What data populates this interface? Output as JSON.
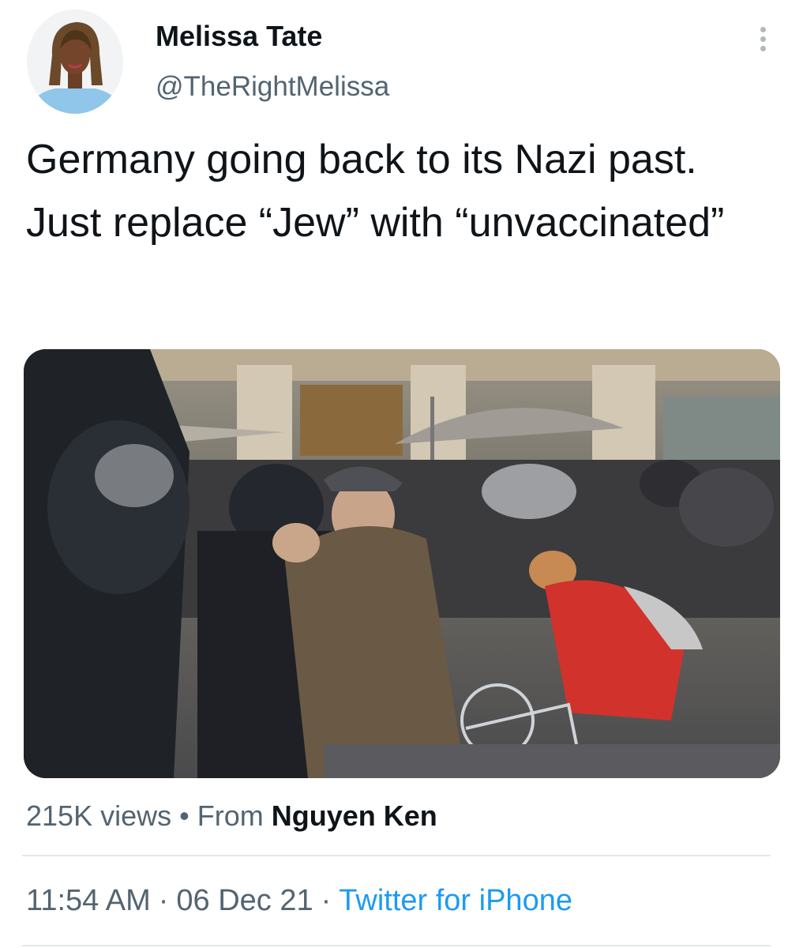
{
  "author": {
    "display_name": "Melissa Tate",
    "handle": "@TheRightMelissa",
    "avatar_icon": "profile-photo"
  },
  "menu_icon": "more-vertical-icon",
  "tweet": {
    "text": "Germany going back to its Nazi past. Just replace “Jew” with “unvaccinated”"
  },
  "media": {
    "type": "video",
    "views": "215K views",
    "separator": "•",
    "from_label": "From",
    "source": "Nguyen Ken"
  },
  "meta": {
    "time": "11:54 AM",
    "date": "06 Dec 21",
    "separator": "·",
    "client": "Twitter for iPhone"
  },
  "colors": {
    "text_primary": "#0f1419",
    "text_secondary": "#536471",
    "link": "#1d9bf0",
    "divider": "#e4e8eb"
  }
}
